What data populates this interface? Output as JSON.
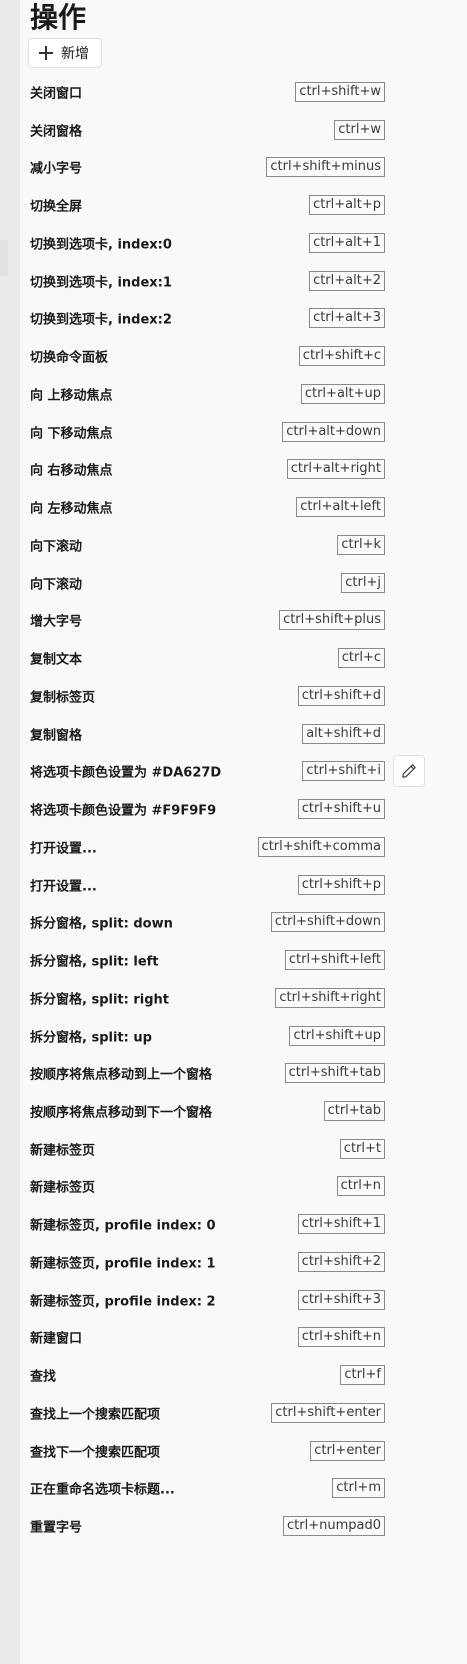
{
  "page": {
    "title": "操作",
    "add_button_label": "新增"
  },
  "actions": [
    {
      "label": "关闭窗口",
      "key": "ctrl+shift+w"
    },
    {
      "label": "关闭窗格",
      "key": "ctrl+w"
    },
    {
      "label": "减小字号",
      "key": "ctrl+shift+minus"
    },
    {
      "label": "切换全屏",
      "key": "ctrl+alt+p"
    },
    {
      "label": "切换到选项卡, index:0",
      "key": "ctrl+alt+1"
    },
    {
      "label": "切换到选项卡, index:1",
      "key": "ctrl+alt+2"
    },
    {
      "label": "切换到选项卡, index:2",
      "key": "ctrl+alt+3"
    },
    {
      "label": "切换命令面板",
      "key": "ctrl+shift+c"
    },
    {
      "label": "向 上移动焦点",
      "key": "ctrl+alt+up"
    },
    {
      "label": "向 下移动焦点",
      "key": "ctrl+alt+down"
    },
    {
      "label": "向 右移动焦点",
      "key": "ctrl+alt+right"
    },
    {
      "label": "向 左移动焦点",
      "key": "ctrl+alt+left"
    },
    {
      "label": "向下滚动",
      "key": "ctrl+k"
    },
    {
      "label": "向下滚动",
      "key": "ctrl+j"
    },
    {
      "label": "增大字号",
      "key": "ctrl+shift+plus"
    },
    {
      "label": "复制文本",
      "key": "ctrl+c"
    },
    {
      "label": "复制标签页",
      "key": "ctrl+shift+d"
    },
    {
      "label": "复制窗格",
      "key": "alt+shift+d"
    },
    {
      "label": "将选项卡颜色设置为 #DA627D",
      "key": "ctrl+shift+i",
      "hovered": true
    },
    {
      "label": "将选项卡颜色设置为 #F9F9F9",
      "key": "ctrl+shift+u"
    },
    {
      "label": "打开设置...",
      "key": "ctrl+shift+comma"
    },
    {
      "label": "打开设置...",
      "key": "ctrl+shift+p"
    },
    {
      "label": "拆分窗格, split: down",
      "key": "ctrl+shift+down"
    },
    {
      "label": "拆分窗格, split: left",
      "key": "ctrl+shift+left"
    },
    {
      "label": "拆分窗格, split: right",
      "key": "ctrl+shift+right"
    },
    {
      "label": "拆分窗格, split: up",
      "key": "ctrl+shift+up"
    },
    {
      "label": "按顺序将焦点移动到上一个窗格",
      "key": "ctrl+shift+tab"
    },
    {
      "label": "按顺序将焦点移动到下一个窗格",
      "key": "ctrl+tab"
    },
    {
      "label": "新建标签页",
      "key": "ctrl+t"
    },
    {
      "label": "新建标签页",
      "key": "ctrl+n"
    },
    {
      "label": "新建标签页, profile index: 0",
      "key": "ctrl+shift+1"
    },
    {
      "label": "新建标签页, profile index: 1",
      "key": "ctrl+shift+2"
    },
    {
      "label": "新建标签页, profile index: 2",
      "key": "ctrl+shift+3"
    },
    {
      "label": "新建窗口",
      "key": "ctrl+shift+n"
    },
    {
      "label": "查找",
      "key": "ctrl+f"
    },
    {
      "label": "查找上一个搜索匹配项",
      "key": "ctrl+shift+enter"
    },
    {
      "label": "查找下一个搜索匹配项",
      "key": "ctrl+enter"
    },
    {
      "label": "正在重命名选项卡标题...",
      "key": "ctrl+m"
    },
    {
      "label": "重置字号",
      "key": "ctrl+numpad0"
    }
  ],
  "icons": {
    "add": "plus-icon",
    "edit": "pencil-icon"
  }
}
